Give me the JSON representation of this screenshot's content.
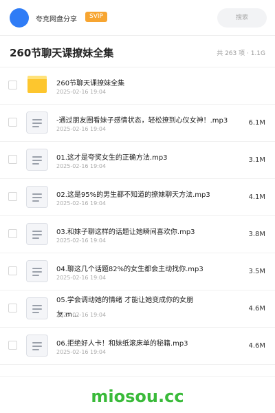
{
  "header": {
    "username": "夸克网盘分享",
    "badge": "SVIP",
    "search_placeholder": "搜索"
  },
  "folder": {
    "title": "260节聊天课撩妹全集",
    "summary": "共 263 项 · 1.1G"
  },
  "items": [
    {
      "type": "folder",
      "name": "260节聊天课撩妹全集",
      "date": "2025-02-16 19:04",
      "size": ""
    },
    {
      "type": "file",
      "name": "-通过朋友圈看妹子感情状态，轻松撩到心仪女神！.mp3",
      "date": "2025-02-16 19:04",
      "size": "6.1M"
    },
    {
      "type": "file",
      "name": "01.这才是夸奖女生的正确方法.mp3",
      "date": "2025-02-16 19:04",
      "size": "3.1M"
    },
    {
      "type": "file",
      "name": "02.这是95%的男生都不知道的撩妹聊天方法.mp3",
      "date": "2025-02-16 19:04",
      "size": "4.1M"
    },
    {
      "type": "file",
      "name": "03.和妹子聊这样的话题让她瞬间喜欢你.mp3",
      "date": "2025-02-16 19:04",
      "size": "3.8M"
    },
    {
      "type": "file",
      "name": "04.聊这几个话题82%的女生都会主动找你.mp3",
      "date": "2025-02-16 19:04",
      "size": "3.5M"
    },
    {
      "type": "file",
      "name": "05.学会调动她的情绪 才能让她变成你的女朋友.m…",
      "date": "2025-02-16 19:04",
      "size": "4.6M"
    },
    {
      "type": "file",
      "name": "06.拒绝好人卡！和妹纸滚床单的秘籍.mp3",
      "date": "2025-02-16 19:04",
      "size": "4.6M"
    }
  ],
  "watermark": "miosou.cc",
  "colors": {
    "accent": "#2f7cf6",
    "svip": "#f7a531",
    "folder": "#fdc62e",
    "watermark": "#3aba3a"
  }
}
